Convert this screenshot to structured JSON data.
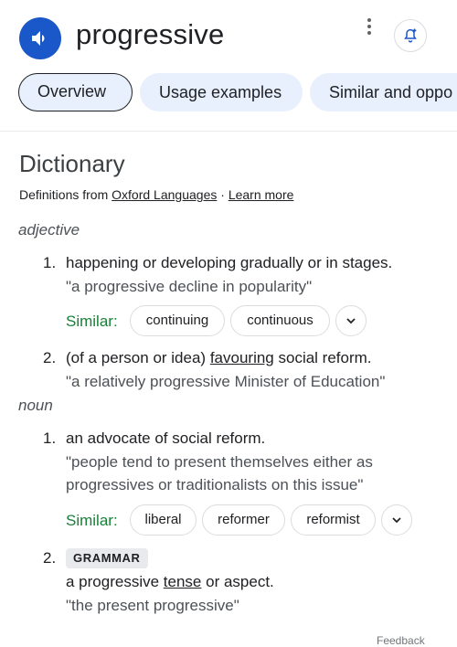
{
  "entry": {
    "word": "progressive"
  },
  "tabs": [
    "Overview",
    "Usage examples",
    "Similar and oppo"
  ],
  "dictionary": {
    "title": "Dictionary",
    "source_prefix": "Definitions from",
    "source_name": "Oxford Languages",
    "source_sep": "·",
    "learn_more": "Learn more"
  },
  "adjective": {
    "label": "adjective",
    "senses": [
      {
        "num": "1.",
        "definition": "happening or developing gradually or in stages.",
        "example": "\"a progressive decline in popularity\"",
        "similar_label": "Similar:",
        "similar": [
          "continuing",
          "continuous"
        ]
      },
      {
        "num": "2.",
        "definition_before": "(of a person or idea)",
        "definition_link": "favouring",
        "definition_after": "social reform.",
        "example": "\"a relatively progressive Minister of Education\""
      }
    ]
  },
  "noun": {
    "label": "noun",
    "senses": [
      {
        "num": "1.",
        "definition": "an advocate of social reform.",
        "example_line1": "\"people tend to present themselves either as",
        "example_line2": "progressives or traditionalists on this issue\"",
        "similar_label": "Similar:",
        "similar": [
          "liberal",
          "reformer",
          "reformist"
        ]
      },
      {
        "num": "2.",
        "badge": "GRAMMAR",
        "definition_before": "a progressive",
        "definition_link": "tense",
        "definition_after": "or aspect.",
        "example": "\"the present progressive\""
      }
    ]
  },
  "footer": {
    "feedback": "Feedback"
  },
  "colors": {
    "accent": "#1a57c9",
    "chip_bg": "#e8f0fe",
    "similar_green": "#188038"
  },
  "icons": [
    "speaker-icon",
    "more-vert-icon",
    "alert-add-icon",
    "chevron-down-icon"
  ]
}
